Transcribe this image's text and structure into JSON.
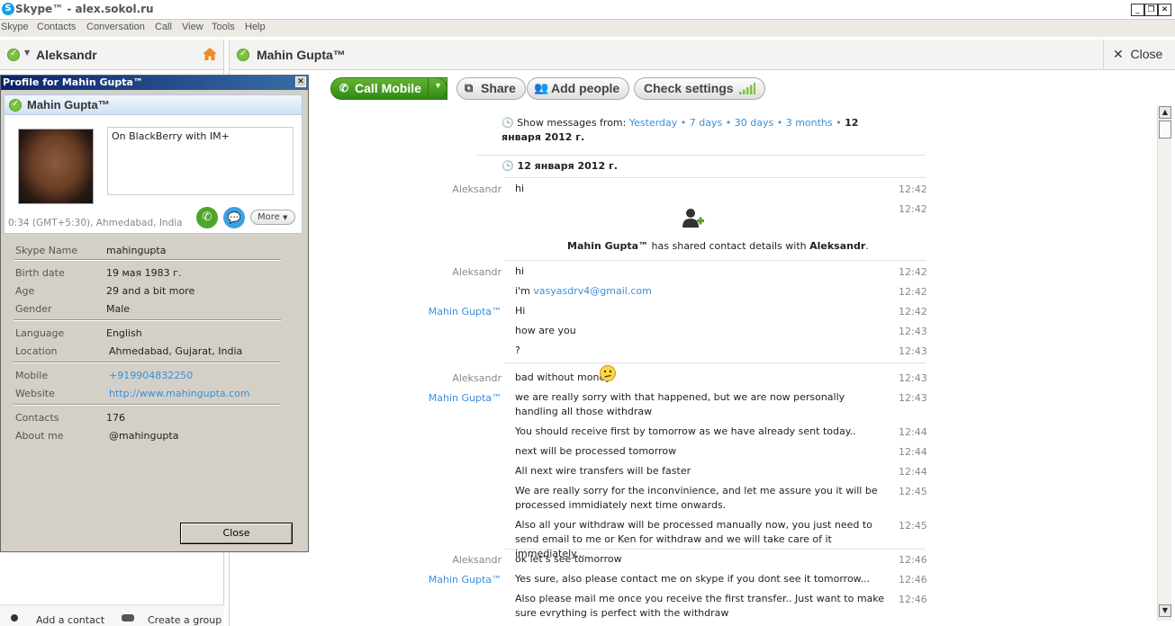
{
  "window": {
    "title": "Skype™ - alex.sokol.ru",
    "logo_letter": "S"
  },
  "menu": [
    "Skype",
    "Contacts",
    "Conversation",
    "Call",
    "View",
    "Tools",
    "Help"
  ],
  "user": {
    "name": "Aleksandr"
  },
  "left_bottom": {
    "add_contact": "Add a contact",
    "create_group": "Create a group"
  },
  "conversation": {
    "name": "Mahin Gupta™",
    "close_label": "Close",
    "toolbar": {
      "call_mobile": "Call Mobile",
      "share": "Share",
      "add_people": "Add people",
      "check_settings": "Check settings"
    },
    "history": {
      "label": "Show messages from:",
      "options": [
        "Yesterday",
        "7 days",
        "30 days",
        "3 months"
      ],
      "separator": "•",
      "current": "12 января 2012 г."
    },
    "date_header": "12 января 2012 г.",
    "shared_contact": {
      "sender": "Mahin Gupta™",
      "text": "has shared contact details with",
      "recipient": "Aleksandr",
      "end": ".",
      "time": "12:42"
    },
    "messages": [
      {
        "sender": "Aleksandr",
        "text": "hi",
        "time": "12:42"
      },
      {
        "sender": "Aleksandr",
        "text": "hi",
        "time": "12:42"
      },
      {
        "sender": "",
        "text_prefix": "i'm ",
        "link": "vasyasdrv4@gmail.com",
        "time": "12:42"
      },
      {
        "sender": "Mahin Gupta™",
        "text": "Hi",
        "time": "12:42"
      },
      {
        "sender": "",
        "text": "how are you",
        "time": "12:43"
      },
      {
        "sender": "",
        "text": "?",
        "time": "12:43"
      },
      {
        "sender": "Aleksandr",
        "text": "bad without money",
        "time": "12:43",
        "emoticon": "confused"
      },
      {
        "sender": "Mahin Gupta™",
        "text": "we are really sorry with that happened, but we are now personally handling all those withdraw",
        "time": "12:43"
      },
      {
        "sender": "",
        "text": "You should receive first by tomorrow as we have already sent today..",
        "time": "12:44"
      },
      {
        "sender": "",
        "text": "next will be processed tomorrow",
        "time": "12:44"
      },
      {
        "sender": "",
        "text": "All next wire transfers will be faster",
        "time": "12:44"
      },
      {
        "sender": "",
        "text": "We are really sorry for the inconvinience, and let me assure you it will be processed immidiately next time onwards.",
        "time": "12:45"
      },
      {
        "sender": "",
        "text": "Also all your withdraw will be processed manually now, you just need to send email to me or Ken for withdraw and we will take care of it immediately...",
        "time": "12:45"
      },
      {
        "sender": "Aleksandr",
        "text": "ok let's see tomorrow",
        "time": "12:46"
      },
      {
        "sender": "Mahin Gupta™",
        "text": "Yes sure, also please contact me on skype if you dont see it tomorrow...",
        "time": "12:46"
      },
      {
        "sender": "",
        "text": "Also please mail me once you receive the first transfer.. Just want to make sure evrything is perfect with the withdraw",
        "time": "12:46"
      }
    ]
  },
  "profile": {
    "window_title": "Profile for Mahin Gupta™",
    "name": "Mahin Gupta™",
    "mood": "On BlackBerry with IM+",
    "local_time": "0:34 (GMT+5:30), Ahmedabad, India",
    "more_label": "More",
    "fields": {
      "skype_name": {
        "label": "Skype Name",
        "value": "mahingupta"
      },
      "birth_date": {
        "label": "Birth date",
        "value": "19 мая 1983 г."
      },
      "age": {
        "label": "Age",
        "value": "29 and a bit more"
      },
      "gender": {
        "label": "Gender",
        "value": "Male"
      },
      "language": {
        "label": "Language",
        "value": "English"
      },
      "location": {
        "label": "Location",
        "value": "Ahmedabad, Gujarat, India"
      },
      "mobile": {
        "label": "Mobile",
        "value": "+919904832250"
      },
      "website": {
        "label": "Website",
        "value": "http://www.mahingupta.com"
      },
      "contacts": {
        "label": "Contacts",
        "value": "176"
      },
      "about_me": {
        "label": "About me",
        "value": "@mahingupta"
      }
    },
    "close_label": "Close"
  },
  "colors": {
    "accent_blue": "#3c8ed8",
    "online_green": "#7cc242",
    "call_green": "#3f9a22"
  }
}
